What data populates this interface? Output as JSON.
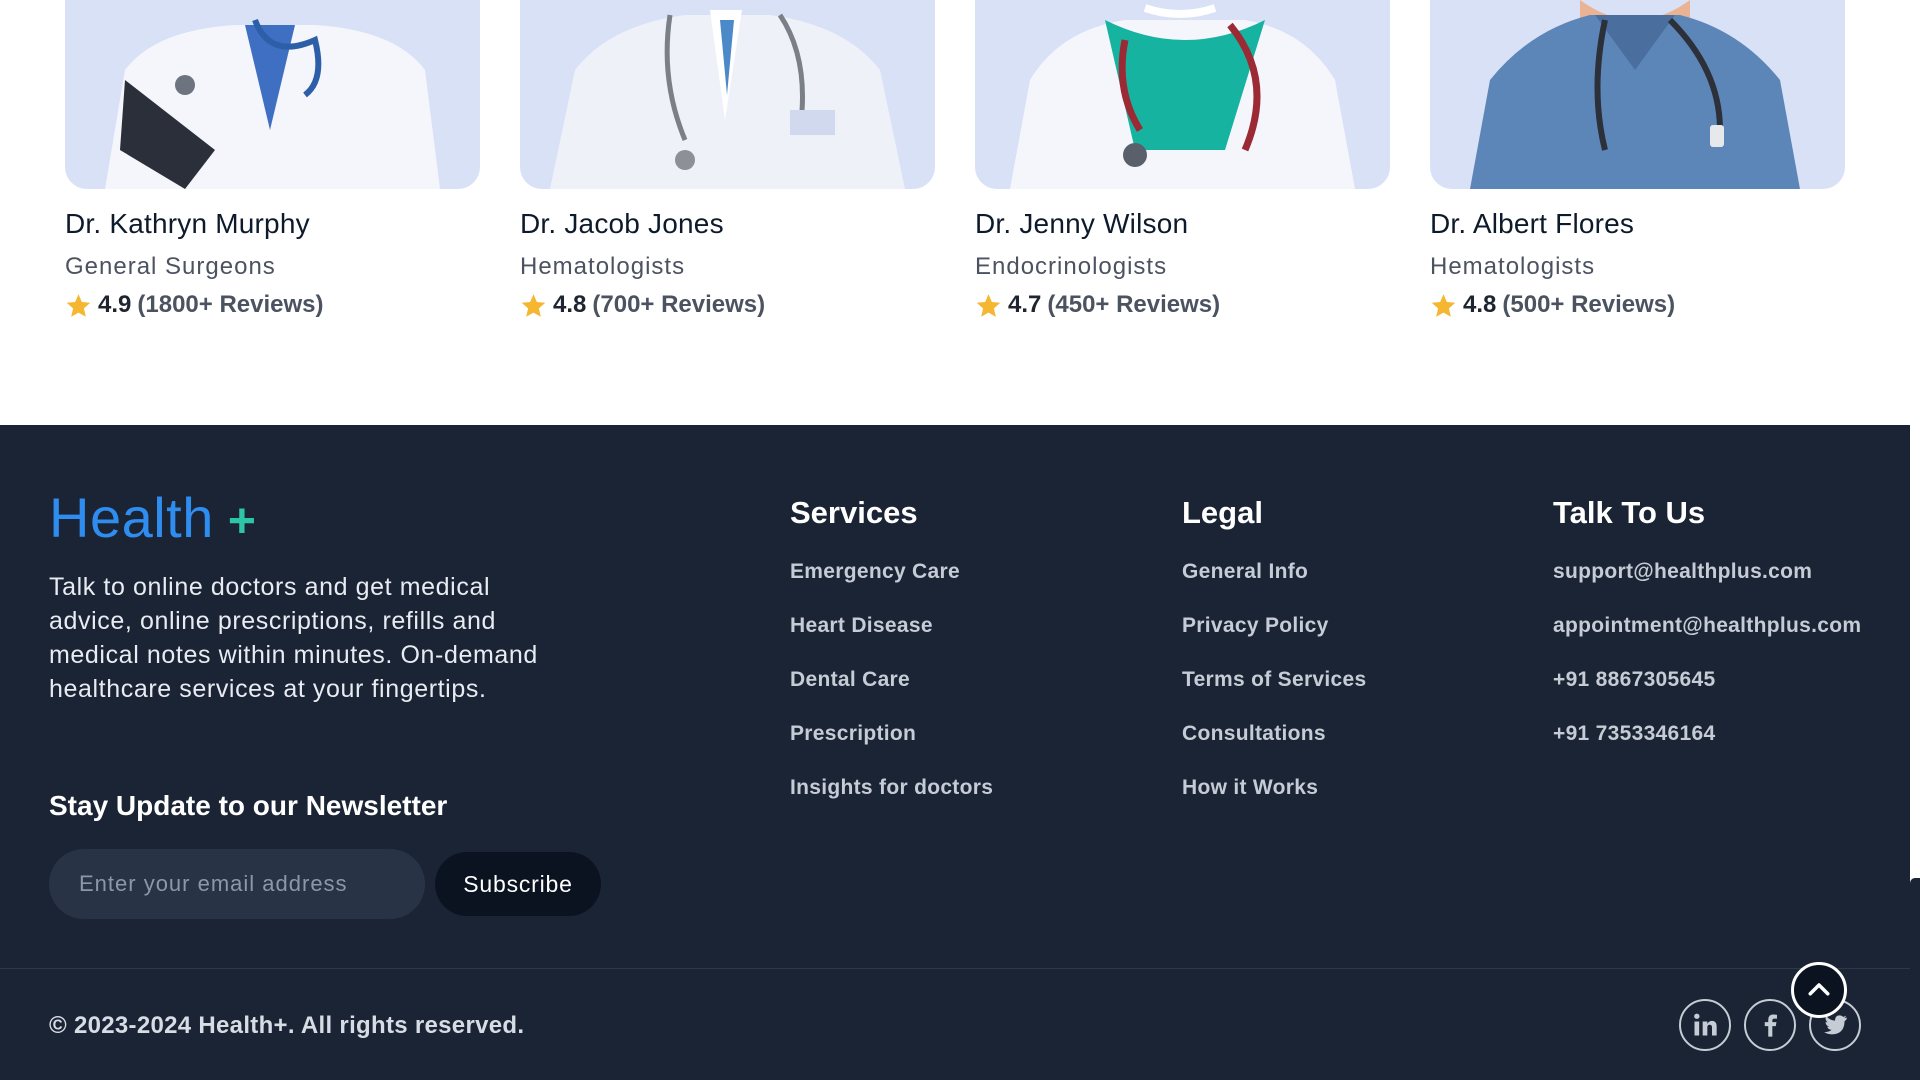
{
  "doctors": [
    {
      "name": "Dr. Kathryn Murphy",
      "specialty": "General Surgeons",
      "rating": "4.9",
      "reviews": "(1800+ Reviews)"
    },
    {
      "name": "Dr. Jacob Jones",
      "specialty": "Hematologists",
      "rating": "4.8",
      "reviews": "(700+ Reviews)"
    },
    {
      "name": "Dr. Jenny Wilson",
      "specialty": "Endocrinologists",
      "rating": "4.7",
      "reviews": "(450+ Reviews)"
    },
    {
      "name": "Dr. Albert Flores",
      "specialty": "Hematologists",
      "rating": "4.8",
      "reviews": "(500+ Reviews)"
    }
  ],
  "footer": {
    "logo_text": "Health",
    "logo_plus": "+",
    "about": "Talk to online doctors and get medical advice, online prescriptions, refills and medical notes within minutes. On-demand healthcare services at your fingertips.",
    "newsletter_title": "Stay Update to our Newsletter",
    "email_placeholder": "Enter your email address",
    "subscribe_label": "Subscribe",
    "services": {
      "title": "Services",
      "items": [
        "Emergency Care",
        "Heart Disease",
        "Dental Care",
        "Prescription",
        "Insights for doctors"
      ]
    },
    "legal": {
      "title": "Legal",
      "items": [
        "General Info",
        "Privacy Policy",
        "Terms of Services",
        "Consultations",
        "How it Works"
      ]
    },
    "contact": {
      "title": "Talk To Us",
      "items": [
        "support@healthplus.com",
        "appointment@healthplus.com",
        "+91 8867305645",
        "+91 7353346164"
      ]
    },
    "copyright": "© 2023-2024 Health+. All rights reserved."
  },
  "colors": {
    "footer_bg": "#1b2434",
    "brand_blue": "#2f8df0",
    "brand_green": "#2ec4a6",
    "star": "#f5b731",
    "photo_bg": "#d9e1f7"
  },
  "icons": {
    "rating": "star-icon",
    "social": [
      "linkedin-icon",
      "facebook-icon",
      "twitter-icon"
    ],
    "scroll_top": "chevron-up-icon"
  }
}
